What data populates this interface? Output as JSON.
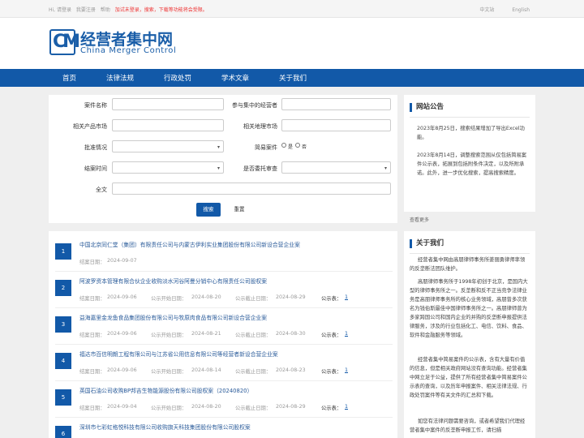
{
  "topbar": {
    "greeting": "Hi, 请登录",
    "register": "我要注册",
    "help": "帮助",
    "notice": "加试未登录，搜索，下载等功能将会受限。",
    "lang_cn": "中文站",
    "lang_en": "English"
  },
  "logo": {
    "cn": "经营者集中网",
    "en": "China Merger Control"
  },
  "nav": [
    "首页",
    "法律法规",
    "行政处罚",
    "学术文章",
    "关于我们"
  ],
  "search": {
    "case_name": "案件名称",
    "parties": "参与集中的经营者",
    "product_market": "相关产品市场",
    "geo_market": "相关地理市场",
    "approval": "批准情况",
    "simple_case": "简易案件",
    "yes": "是",
    "no": "否",
    "close_time": "结案时间",
    "entrusted": "是否委托审查",
    "fulltext": "全文",
    "search_btn": "搜索",
    "reset_btn": "重置"
  },
  "results": [
    {
      "n": "1",
      "title": "中国北京同仁堂（集团）有限责任公司与内蒙古伊利实业集团股份有限公司新设合营企业案",
      "close_label": "结案日期：",
      "close": "2024-09-07",
      "start_label": "",
      "start": "",
      "end_label": "",
      "end": "",
      "pub": ""
    },
    {
      "n": "2",
      "title": "阿波罗资本管理有限合伙企业收购淡水河谷阿曼分销中心有限责任公司股权案",
      "close_label": "结案日期：",
      "close": "2024-09-06",
      "start_label": "公示开始日期：",
      "start": "2024-08-20",
      "end_label": "公示截止日期：",
      "end": "2024-08-29",
      "pub": "1"
    },
    {
      "n": "3",
      "title": "益海嘉里金龙鱼食品集团股份有限公司与牧原肉食品有限公司新设合营企业案",
      "close_label": "结案日期：",
      "close": "2024-09-06",
      "start_label": "公示开始日期：",
      "start": "2024-08-21",
      "end_label": "公示截止日期：",
      "end": "2024-08-30",
      "pub": "1"
    },
    {
      "n": "4",
      "title": "福达市百信明朗工程有限公司与江苏省公用信息有限公司等经营者新设合营企业案",
      "close_label": "结案日期：",
      "close": "2024-09-06",
      "start_label": "公示开始日期：",
      "start": "2024-08-14",
      "end_label": "公示截止日期：",
      "end": "2024-08-23",
      "pub": "1"
    },
    {
      "n": "5",
      "title": "英国石油公司收购BP邦吉生物能源股份有限公司股权案（20240820）",
      "close_label": "结案日期：",
      "close": "2024-09-04",
      "start_label": "公示开始日期：",
      "start": "2024-08-20",
      "end_label": "公示截止日期：",
      "end": "2024-08-29",
      "pub": "1"
    },
    {
      "n": "6",
      "title": "深圳市七彩虹格悦科技有限公司收购旗天科技集团股份有限公司股权案",
      "close_label": "",
      "close": "",
      "start_label": "",
      "start": "",
      "end_label": "",
      "end": "",
      "pub": ""
    }
  ],
  "pub_label": "公示表：",
  "announce": {
    "title": "网站公告",
    "p1": "2023年8月25日，搜索结果增加了导出Excel功能。",
    "p2": "2023年8月14日，调整搜索范围从仅包括简易案件公示表，拓展到包括附条件决定，以及所附承诺。此外，进一步优化搜索，提高搜索精度。",
    "more": "查看更多"
  },
  "about": {
    "title": "关于我们",
    "p1": "经营者集中网由高朋律师事务所姜丽勇律师率领的反垄断法团队维护。",
    "p2": "高朋律师事务所于1998年初创于北京，是国内大型的律师事务所之一。反垄断和反不正当竞争法律业务是高朋律师事务所的核心业务领域，高朋曾多次获名为钱伯斯最佳中国律师事务所之一。高朋律师曾为多家跨国公司和国内企业的并购的反垄断申报提供法律服务，涉及的行业包括化工、电信、饮料、食品、软件和金融服务等领域。",
    "p3": "经营者集中简易案件的公示表，含有大量有价值的信息，但是相关政府网站没有查询功能。经营者集中网立足于公益，提供了所有经营者集中简易案件公示表的查询，以及历年申报案件、相关法律法规、行政处罚案件等有关文件的汇总和下载。",
    "p4": "如您有法律问题需要咨询，或者希望我们代理经营者集中案件的反垄断申报工作，请扫描"
  }
}
